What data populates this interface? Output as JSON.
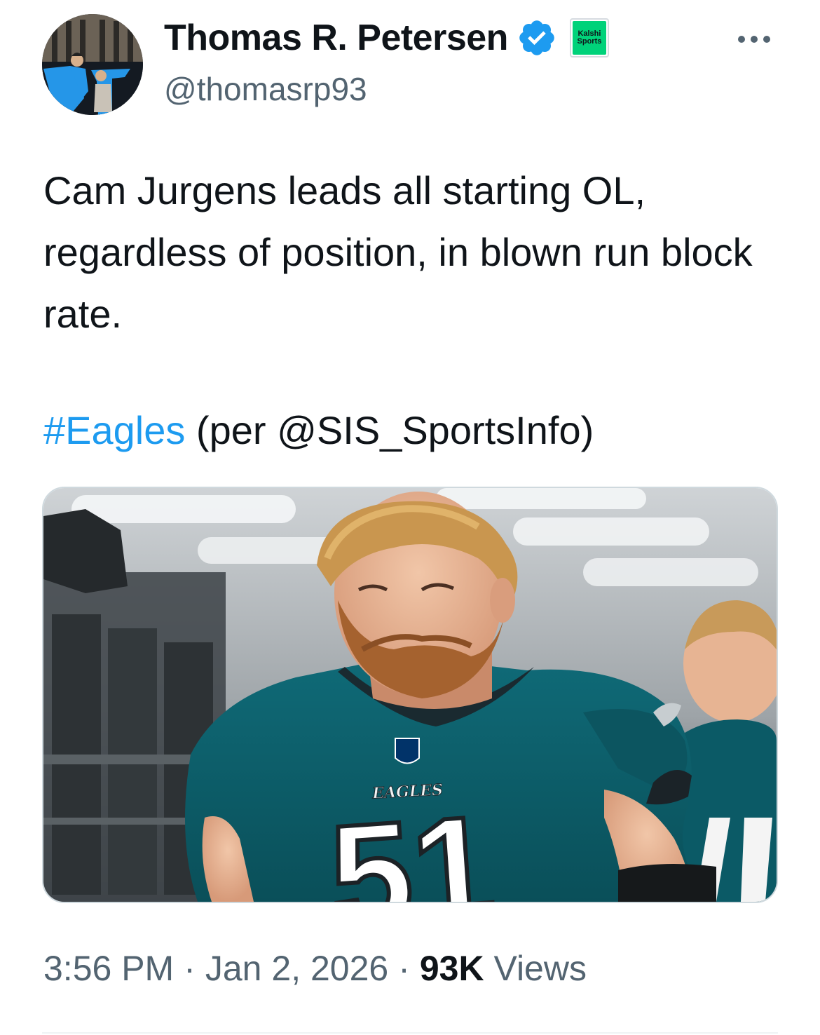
{
  "author": {
    "display_name": "Thomas R. Petersen",
    "handle": "@thomasrp93",
    "verified": true,
    "affiliate_badge": {
      "line1": "Kalshi",
      "line2": "Sports"
    }
  },
  "more_icon": "more-horizontal-icon",
  "tweet": {
    "text": "Cam Jurgens leads all starting OL, regardless of position, in blown run block rate.",
    "hashtag": "#Eagles",
    "after_hashtag": " (per @SIS_SportsInfo)"
  },
  "media": {
    "jersey_wordmark": "EAGLES",
    "jersey_number": "51"
  },
  "meta": {
    "time": "3:56 PM",
    "separator": "·",
    "date": "Jan 2, 2026",
    "views_count": "93K",
    "views_label": "Views"
  },
  "colors": {
    "link": "#1d9bf0",
    "secondary_text": "#536471",
    "verified": "#1d9bf0",
    "jersey_teal": "#0d5f6b"
  }
}
